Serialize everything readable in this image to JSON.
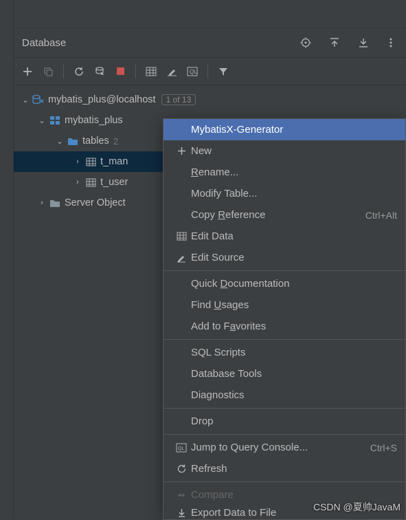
{
  "panel": {
    "title": "Database"
  },
  "tree": {
    "datasource": {
      "label": "mybatis_plus@localhost",
      "badge": "1 of 13"
    },
    "schema": {
      "label": "mybatis_plus"
    },
    "tables_group": {
      "label": "tables",
      "count": "2"
    },
    "table1": {
      "label": "t_man"
    },
    "table2": {
      "label": "t_user"
    },
    "server_objects": {
      "label": "Server Object"
    }
  },
  "menu": {
    "mybatisx": "MybatisX-Generator",
    "new": "New",
    "rename": "ename...",
    "rename_u": "R",
    "modify": "Modify Table...",
    "copyref": "Copy ",
    "copyref_u": "R",
    "copyref2": "eference",
    "copyref_shortcut": "Ctrl+Alt",
    "editdata": "Edit Data",
    "editsource": "Edit Source",
    "quickdoc1": "Quick ",
    "quickdoc_u": "D",
    "quickdoc2": "ocumentation",
    "findusages1": "Find ",
    "findusages_u": "U",
    "findusages2": "sages",
    "addfav1": "Add to F",
    "addfav_u": "a",
    "addfav2": "vorites",
    "sqlscripts": "SQL Scripts",
    "dbtools": "Database Tools",
    "diagnostics": "Diagnostics",
    "drop": "Drop",
    "jumpconsole": "Jump to Query Console...",
    "jumpconsole_shortcut": "Ctrl+S",
    "refresh": "Refresh",
    "compare": "Compare",
    "export": "Export Data to File"
  },
  "watermark": "CSDN @夏帅JavaM"
}
